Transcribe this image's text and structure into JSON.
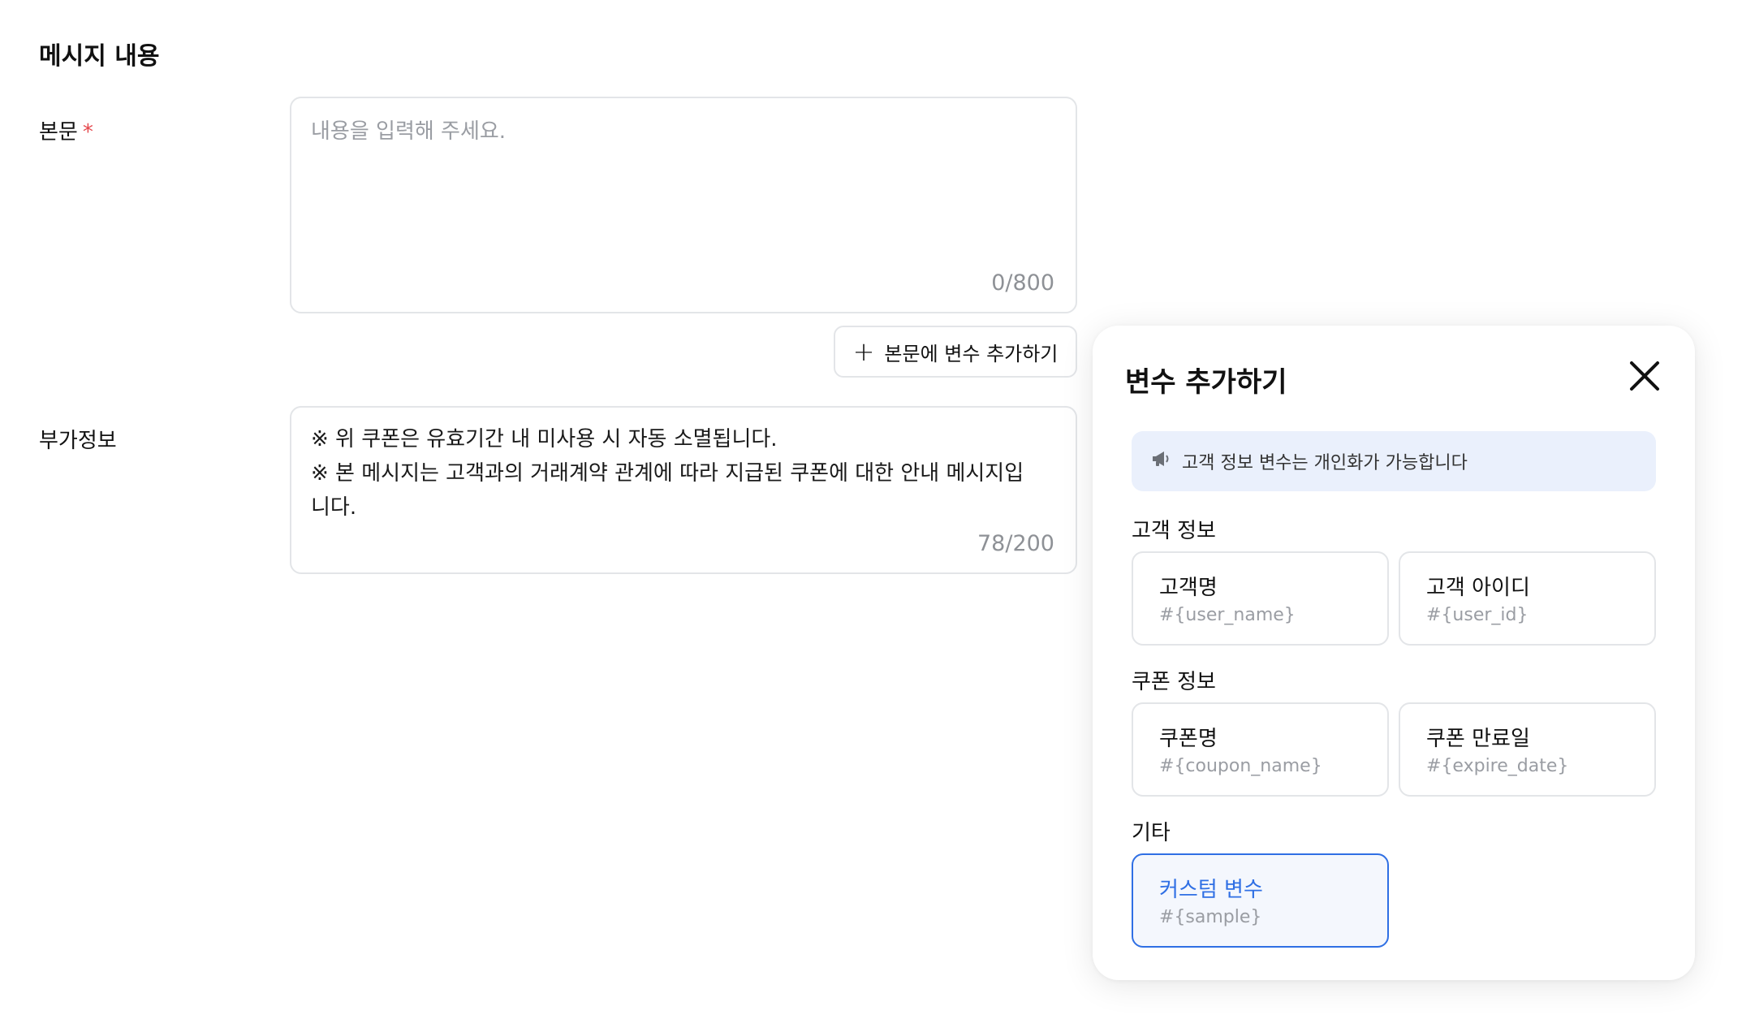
{
  "section_title": "메시지 내용",
  "body_field": {
    "label": "본문",
    "required_mark": "*",
    "placeholder": "내용을 입력해 주세요.",
    "counter": "0/800"
  },
  "add_variable_button": {
    "icon": "plus-icon",
    "label": "본문에 변수 추가하기"
  },
  "extra_field": {
    "label": "부가정보",
    "lines": [
      "※ 위 쿠폰은 유효기간 내 미사용 시 자동 소멸됩니다.",
      "※ 본 메시지는 고객과의 거래계약 관계에 따라 지급된 쿠폰에 대한 안내 메시지입니다."
    ],
    "counter": "78/200"
  },
  "variable_panel": {
    "title": "변수 추가하기",
    "close_icon": "close-icon",
    "notice": {
      "icon": "megaphone-icon",
      "text": "고객 정보 변수는 개인화가 가능합니다"
    },
    "groups": [
      {
        "label": "고객 정보",
        "items": [
          {
            "name": "고객명",
            "code": "#{user_name}"
          },
          {
            "name": "고객 아이디",
            "code": "#{user_id}"
          }
        ]
      },
      {
        "label": "쿠폰 정보",
        "items": [
          {
            "name": "쿠폰명",
            "code": "#{coupon_name}"
          },
          {
            "name": "쿠폰 만료일",
            "code": "#{expire_date}"
          }
        ]
      },
      {
        "label": "기타",
        "items": [
          {
            "name": "커스텀 변수",
            "code": "#{sample}",
            "selected": true
          }
        ]
      }
    ]
  },
  "colors": {
    "accent": "#2f6fe4",
    "required": "#e5484d",
    "notice_bg": "#eaf0fc"
  }
}
